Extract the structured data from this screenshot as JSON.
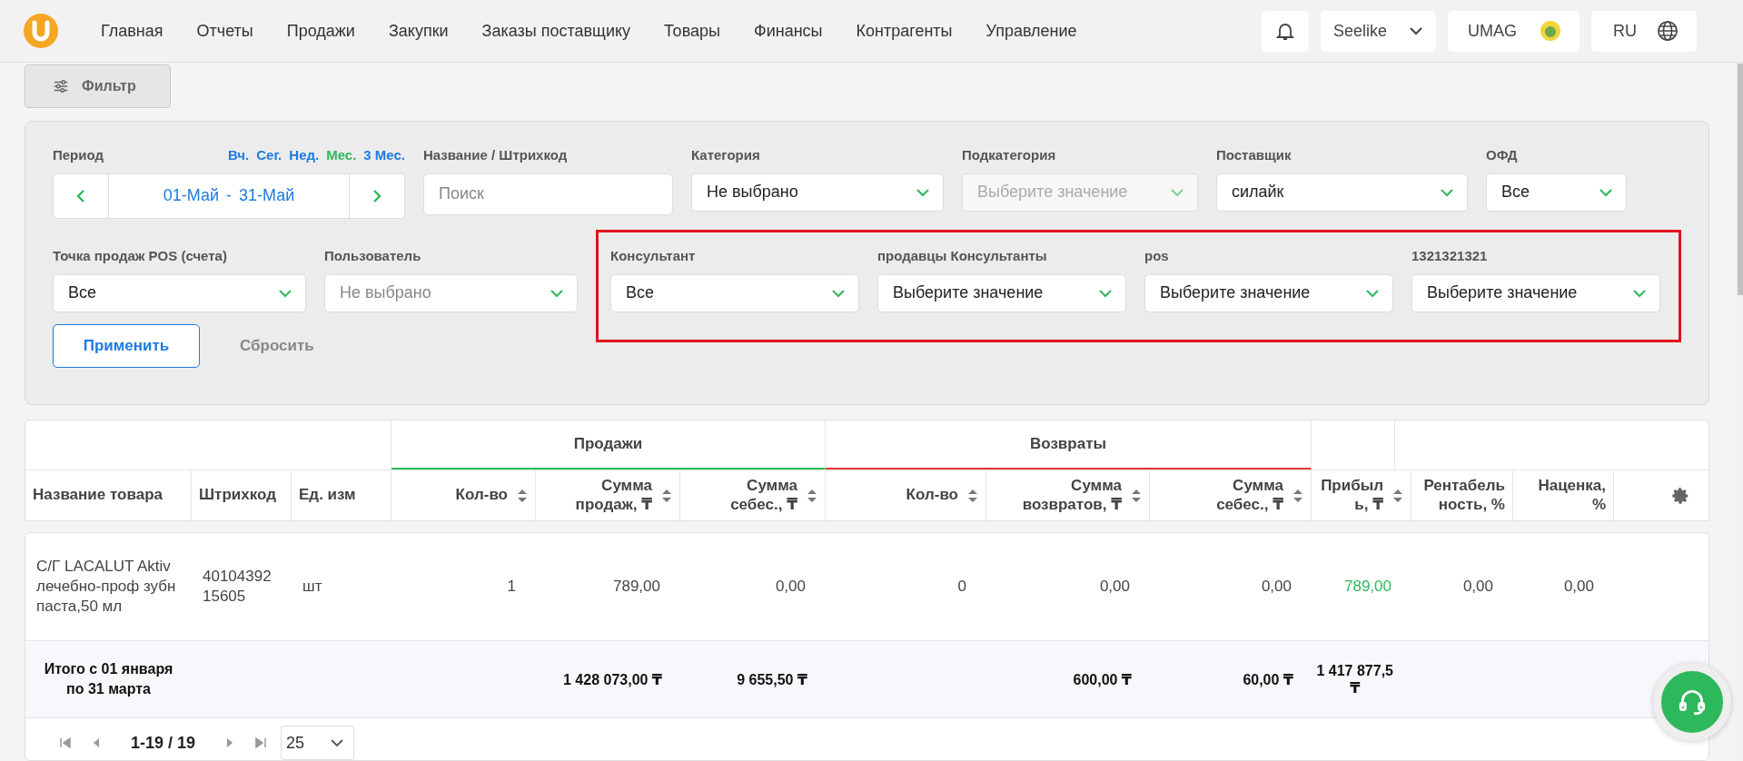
{
  "nav": {
    "items": [
      {
        "label": "Главная"
      },
      {
        "label": "Отчеты"
      },
      {
        "label": "Продажи"
      },
      {
        "label": "Закупки"
      },
      {
        "label": "Заказы поставщику"
      },
      {
        "label": "Товары"
      },
      {
        "label": "Финансы"
      },
      {
        "label": "Контрагенты"
      },
      {
        "label": "Управление"
      }
    ],
    "account": "Seelike",
    "brand": "UMAG",
    "language": "RU"
  },
  "filter_button": "Фильтр",
  "filters": {
    "period": {
      "label": "Период",
      "presets": [
        {
          "label": "Вч.",
          "selected": false
        },
        {
          "label": "Сег.",
          "selected": false
        },
        {
          "label": "Нед.",
          "selected": false
        },
        {
          "label": "Мес.",
          "selected": true
        },
        {
          "label": "3 Мес.",
          "selected": false
        }
      ],
      "range_start": "01-Май",
      "separator": "-",
      "range_end": "31-Май"
    },
    "row1": [
      {
        "label": "Название / Штрихкод",
        "kind": "search",
        "placeholder": "Поиск",
        "disabled": false
      },
      {
        "label": "Категория",
        "kind": "select",
        "value": "Не выбрано",
        "disabled": false
      },
      {
        "label": "Подкатегория",
        "kind": "select",
        "placeholder": "Выберите значение",
        "disabled": true
      },
      {
        "label": "Поставщик",
        "kind": "select",
        "value": "силайк",
        "disabled": false
      },
      {
        "label": "ОФД",
        "kind": "select",
        "value": "Все",
        "disabled": false
      }
    ],
    "row2": [
      {
        "label": "Точка продаж POS (счета)",
        "kind": "select",
        "value": "Все",
        "disabled": false
      },
      {
        "label": "Пользователь",
        "kind": "select",
        "placeholder": "Не выбрано",
        "disabled": false
      }
    ],
    "highlighted": [
      {
        "label": "Консультант",
        "kind": "select",
        "value": "Все",
        "disabled": false
      },
      {
        "label": "продавцы Консультанты",
        "kind": "select",
        "value": "Выберите значение",
        "disabled": false
      },
      {
        "label": "pos",
        "kind": "select",
        "value": "Выберите значение",
        "disabled": false
      },
      {
        "label": "1321321321",
        "kind": "select",
        "value": "Выберите значение",
        "disabled": false
      }
    ],
    "apply": "Применить",
    "reset": "Сбросить"
  },
  "table": {
    "groups": [
      {
        "label": "Продажи",
        "color": "#2eb85c"
      },
      {
        "label": "Возвраты",
        "color": "#e53935"
      }
    ],
    "columns": [
      {
        "label": "Название товара",
        "sortable": false,
        "kind": "text"
      },
      {
        "label": "Штрихкод",
        "sortable": false,
        "kind": "text"
      },
      {
        "label": "Ед. изм",
        "sortable": false,
        "kind": "text"
      },
      {
        "label": "Кол-во",
        "sortable": true,
        "kind": "number"
      },
      {
        "label": "Сумма продаж, ₸",
        "sortable": true,
        "kind": "number"
      },
      {
        "label": "Сумма себес., ₸",
        "sortable": true,
        "kind": "number"
      },
      {
        "label": "Кол-во",
        "sortable": true,
        "kind": "number"
      },
      {
        "label": "Сумма возвратов, ₸",
        "sortable": true,
        "kind": "number"
      },
      {
        "label": "Сумма себес., ₸",
        "sortable": true,
        "kind": "number"
      },
      {
        "label": "Прибыль, ₸",
        "sortable": true,
        "kind": "narrow"
      },
      {
        "label": "Рентабельность, %",
        "sortable": false,
        "kind": "narrow"
      },
      {
        "label": "Наценка, %",
        "sortable": false,
        "kind": "number"
      },
      {
        "kind": "settings"
      }
    ],
    "rows": [
      {
        "cells": [
          {
            "text": "С/Г LACALUT Aktiv лечебно-проф зубн паста,50 мл",
            "positive": false
          },
          {
            "text": "4010439215605",
            "positive": false
          },
          {
            "text": "шт",
            "positive": false
          },
          {
            "text": "1",
            "positive": false
          },
          {
            "text": "789,00",
            "positive": false
          },
          {
            "text": "0,00",
            "positive": false
          },
          {
            "text": "0",
            "positive": false
          },
          {
            "text": "0,00",
            "positive": false
          },
          {
            "text": "0,00",
            "positive": false
          },
          {
            "text": "789,00",
            "positive": true
          },
          {
            "text": "0,00",
            "positive": false
          },
          {
            "text": "0,00",
            "positive": false
          }
        ]
      }
    ],
    "total": {
      "label": "Итого с 01 января по 31 марта",
      "cells": [
        "",
        "",
        "",
        "1 428 073,00 ₸",
        "9 655,50 ₸",
        "",
        "600,00 ₸",
        "60,00 ₸",
        "1 417 877,5\n₸",
        "",
        ""
      ]
    }
  },
  "pagination": {
    "range": "1-19 / 19",
    "page_size": "25"
  }
}
